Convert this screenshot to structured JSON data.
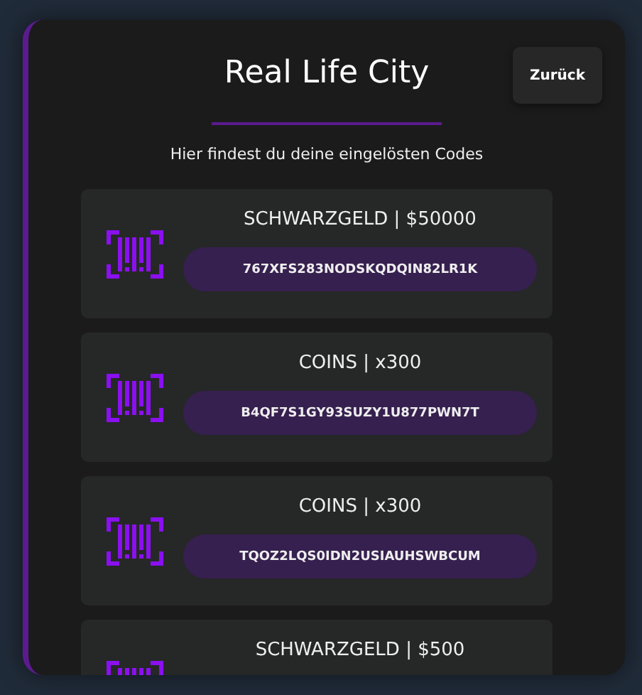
{
  "panel": {
    "title": "Real Life City",
    "back_button": "Zurück",
    "subtitle": "Hier findest du deine eingelösten Codes"
  },
  "codes": [
    {
      "reward": "SCHWARZGELD | $50000",
      "code": "767XFS283NODSKQDQIN82LR1K"
    },
    {
      "reward": "COINS | x300",
      "code": "B4QF7S1GY93SUZY1U877PWN7T"
    },
    {
      "reward": "COINS | x300",
      "code": "TQOZ2LQS0IDN2USIAUHSWBCUM"
    },
    {
      "reward": "SCHWARZGELD | $500"
    }
  ]
}
